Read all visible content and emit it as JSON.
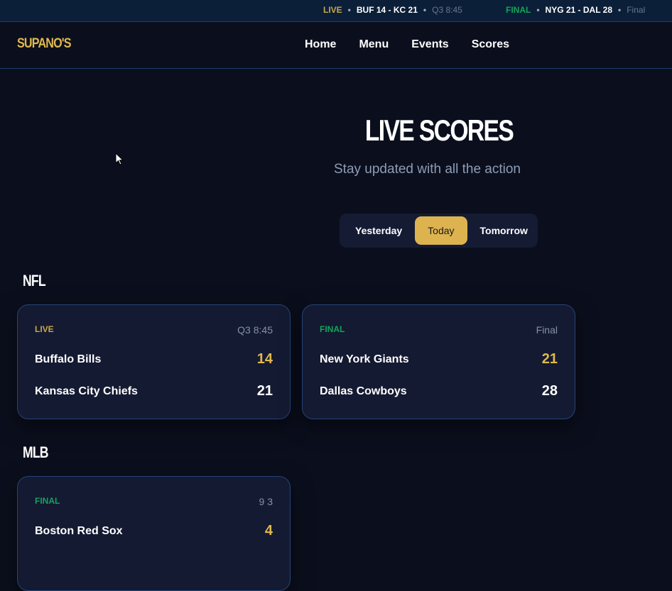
{
  "ticker": [
    {
      "status": "LIVE",
      "score": "BUF 14 - KC 21",
      "time": "Q3 8:45"
    },
    {
      "status": "FINAL",
      "score": "NYG 21 - DAL 28",
      "time": "Final"
    }
  ],
  "ticker_sep": "•",
  "logo": "SUPANO'S",
  "nav": [
    "Home",
    "Menu",
    "Events",
    "Scores"
  ],
  "title": "LIVE SCORES",
  "subtitle": "Stay updated with all the action",
  "days": [
    "Yesterday",
    "Today",
    "Tomorrow"
  ],
  "selected_day": "Today",
  "sections": [
    {
      "name": "NFL",
      "games": [
        {
          "status": "LIVE",
          "time": "Q3 8:45",
          "teams": [
            {
              "name": "Buffalo Bills",
              "score": "14"
            },
            {
              "name": "Kansas City Chiefs",
              "score": "21"
            }
          ]
        },
        {
          "status": "FINAL",
          "time": "Final",
          "teams": [
            {
              "name": "New York Giants",
              "score": "21"
            },
            {
              "name": "Dallas Cowboys",
              "score": "28"
            }
          ]
        }
      ]
    },
    {
      "name": "MLB",
      "games": [
        {
          "status": "FINAL",
          "time": "9 3",
          "teams": [
            {
              "name": "Boston Red Sox",
              "score": "4"
            }
          ]
        }
      ]
    }
  ]
}
